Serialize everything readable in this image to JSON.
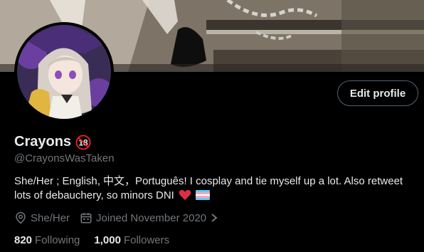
{
  "profile": {
    "display_name": "Crayons",
    "age_badge_icon": "age-18-badge-icon",
    "handle": "@CrayonsWasTaken",
    "bio": "She/Her ; English, 中文，Português! I cosplay and tie myself up a lot. Also retweet lots of debauchery, so minors DNI",
    "bio_emojis": [
      "red-heart-icon",
      "transgender-flag-icon"
    ]
  },
  "actions": {
    "edit_profile_label": "Edit profile"
  },
  "meta": {
    "location": "She/Her",
    "location_icon": "location-pin-icon",
    "joined": "Joined November 2020",
    "joined_icon": "calendar-icon"
  },
  "stats": {
    "following_count": "820",
    "following_label": "Following",
    "followers_count": "1,000",
    "followers_label": "Followers"
  },
  "colors": {
    "background": "#000000",
    "text_primary": "#e7e9ea",
    "text_secondary": "#71767b",
    "button_border": "#536471",
    "badge_red": "#f4212e"
  }
}
